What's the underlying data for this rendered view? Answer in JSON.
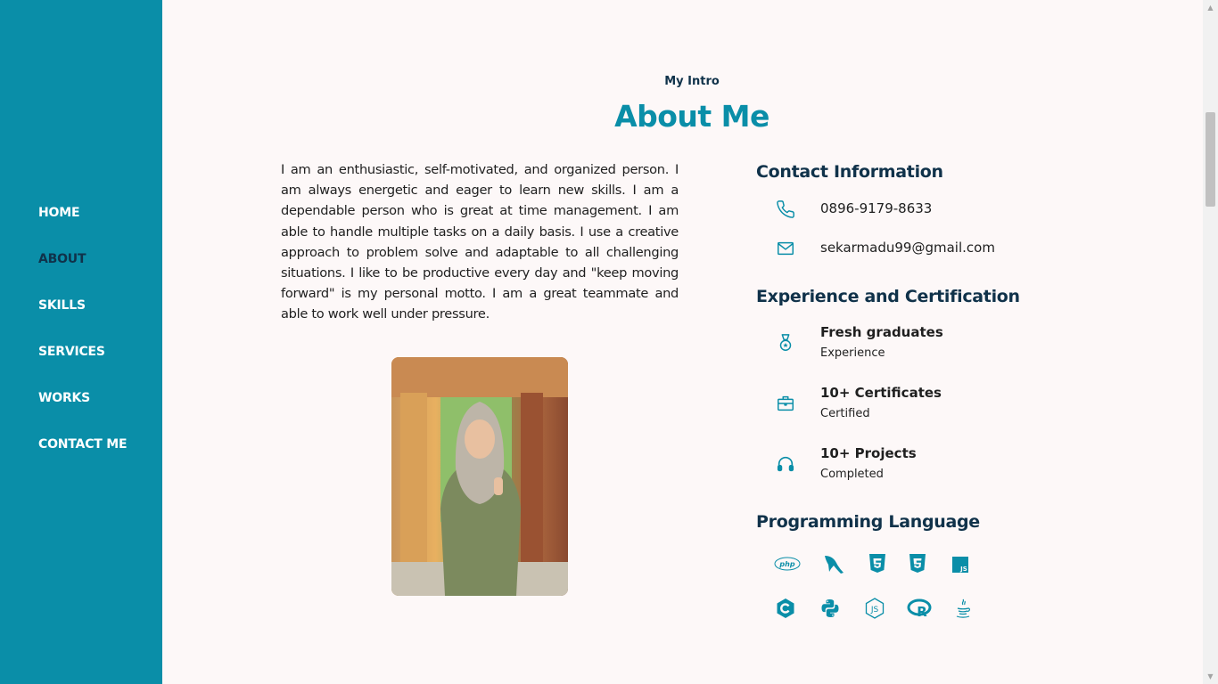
{
  "nav": {
    "items": [
      {
        "label": "HOME"
      },
      {
        "label": "ABOUT",
        "active": true
      },
      {
        "label": "SKILLS"
      },
      {
        "label": "SERVICES"
      },
      {
        "label": "WORKS"
      },
      {
        "label": "CONTACT ME"
      }
    ]
  },
  "about": {
    "subtitle": "My Intro",
    "title": "About Me",
    "bio": "I am an enthusiastic, self-motivated, and organized person. I am always energetic and eager to learn new skills. I am a dependable person who is great at time management. I am able to handle multiple tasks on a daily basis. I use a creative approach to problem solve and adaptable to all challenging situations. I like to be productive every day and \"keep moving forward\" is my personal motto. I am a great teammate and able to work well under pressure."
  },
  "contact": {
    "heading": "Contact Information",
    "phone": "0896-9179-8633",
    "email": "sekarmadu99@gmail.com"
  },
  "experience": {
    "heading": "Experience and Certification",
    "items": [
      {
        "title": "Fresh graduates",
        "subtitle": "Experience",
        "icon": "medal-icon"
      },
      {
        "title": "10+ Certificates",
        "subtitle": "Certified",
        "icon": "briefcase-icon"
      },
      {
        "title": "10+ Projects",
        "subtitle": "Completed",
        "icon": "headset-icon"
      }
    ]
  },
  "languages": {
    "heading": "Programming Language",
    "icons": [
      "php-icon",
      "mysql-icon",
      "html5-icon",
      "css3-icon",
      "javascript-icon",
      "c-icon",
      "python-icon",
      "nodejs-icon",
      "r-icon",
      "java-icon"
    ]
  },
  "colors": {
    "accent": "#0a8ea8",
    "dark": "#10324a",
    "background": "#fdf8f8"
  }
}
